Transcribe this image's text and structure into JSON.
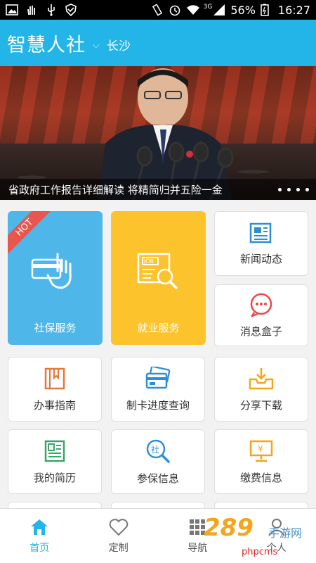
{
  "status_bar": {
    "battery": "56%",
    "network": "3G",
    "time": "16:27"
  },
  "header": {
    "title": "智慧人社",
    "city": "长沙"
  },
  "banner": {
    "caption": "省政府工作报告详细解读 将精简归并五险一金"
  },
  "tiles": {
    "social_insurance": {
      "label": "社保服务",
      "badge": "HOT"
    },
    "employment": {
      "label": "就业服务"
    },
    "news": {
      "label": "新闻动态"
    },
    "messages": {
      "label": "消息盒子"
    },
    "guide": {
      "label": "办事指南"
    },
    "card_progress": {
      "label": "制卡进度查询"
    },
    "share": {
      "label": "分享下载"
    },
    "resume": {
      "label": "我的简历"
    },
    "insurance_info": {
      "label": "参保信息"
    },
    "payment_info": {
      "label": "缴费信息"
    }
  },
  "bottom_nav": {
    "home": "首页",
    "custom": "定制",
    "navigate": "导航",
    "personal": "个人"
  },
  "watermark": {
    "logo": "289",
    "sub": "手游网",
    "site": "phpcms"
  },
  "colors": {
    "brand": "#23b5e8",
    "social_tile": "#4fb6ea",
    "employment_tile": "#fcc32c",
    "hot_ribbon": "#e8574d"
  }
}
